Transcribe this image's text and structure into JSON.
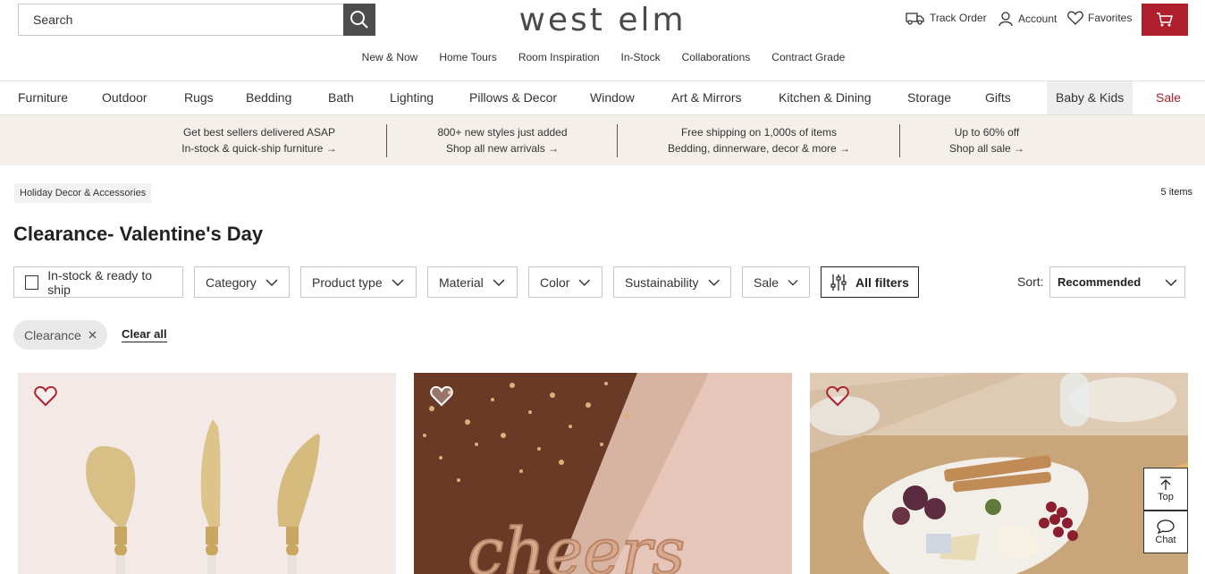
{
  "header": {
    "search_placeholder": "Search",
    "logo": "west elm",
    "track_order": "Track Order",
    "account": "Account",
    "favorites": "Favorites"
  },
  "subnav": [
    "New & Now",
    "Home Tours",
    "Room Inspiration",
    "In-Stock",
    "Collaborations",
    "Contract Grade"
  ],
  "mainnav": [
    "Furniture",
    "Outdoor",
    "Rugs",
    "Bedding",
    "Bath",
    "Lighting",
    "Pillows & Decor",
    "Window",
    "Art & Mirrors",
    "Kitchen & Dining",
    "Storage",
    "Gifts",
    "Baby & Kids",
    "Sale"
  ],
  "promos": [
    {
      "line1": "Get best sellers delivered ASAP",
      "line2": "In-stock & quick-ship furniture →"
    },
    {
      "line1": "800+ new styles just added",
      "line2": "Shop all new arrivals →"
    },
    {
      "line1": "Free shipping on 1,000s of items",
      "line2": "Bedding, dinnerware, decor & more →"
    },
    {
      "line1": "Up to 60% off",
      "line2": "Shop all sale →"
    }
  ],
  "breadcrumb": "Holiday Decor & Accessories",
  "item_count": "5 items",
  "page_title": "Clearance- Valentine's Day",
  "filters": {
    "instock": "In-stock & ready to ship",
    "category": "Category",
    "product_type": "Product type",
    "material": "Material",
    "color": "Color",
    "sustainability": "Sustainability",
    "sale": "Sale",
    "all_filters": "All filters"
  },
  "sort": {
    "label": "Sort:",
    "value": "Recommended"
  },
  "active_filter": "Clearance",
  "clear_all": "Clear all",
  "floating": {
    "top": "Top",
    "chat": "Chat"
  },
  "colors": {
    "brand_red": "#b01e2e",
    "promo_bg": "#f4efe9",
    "search_btn": "#4d4d4d"
  }
}
